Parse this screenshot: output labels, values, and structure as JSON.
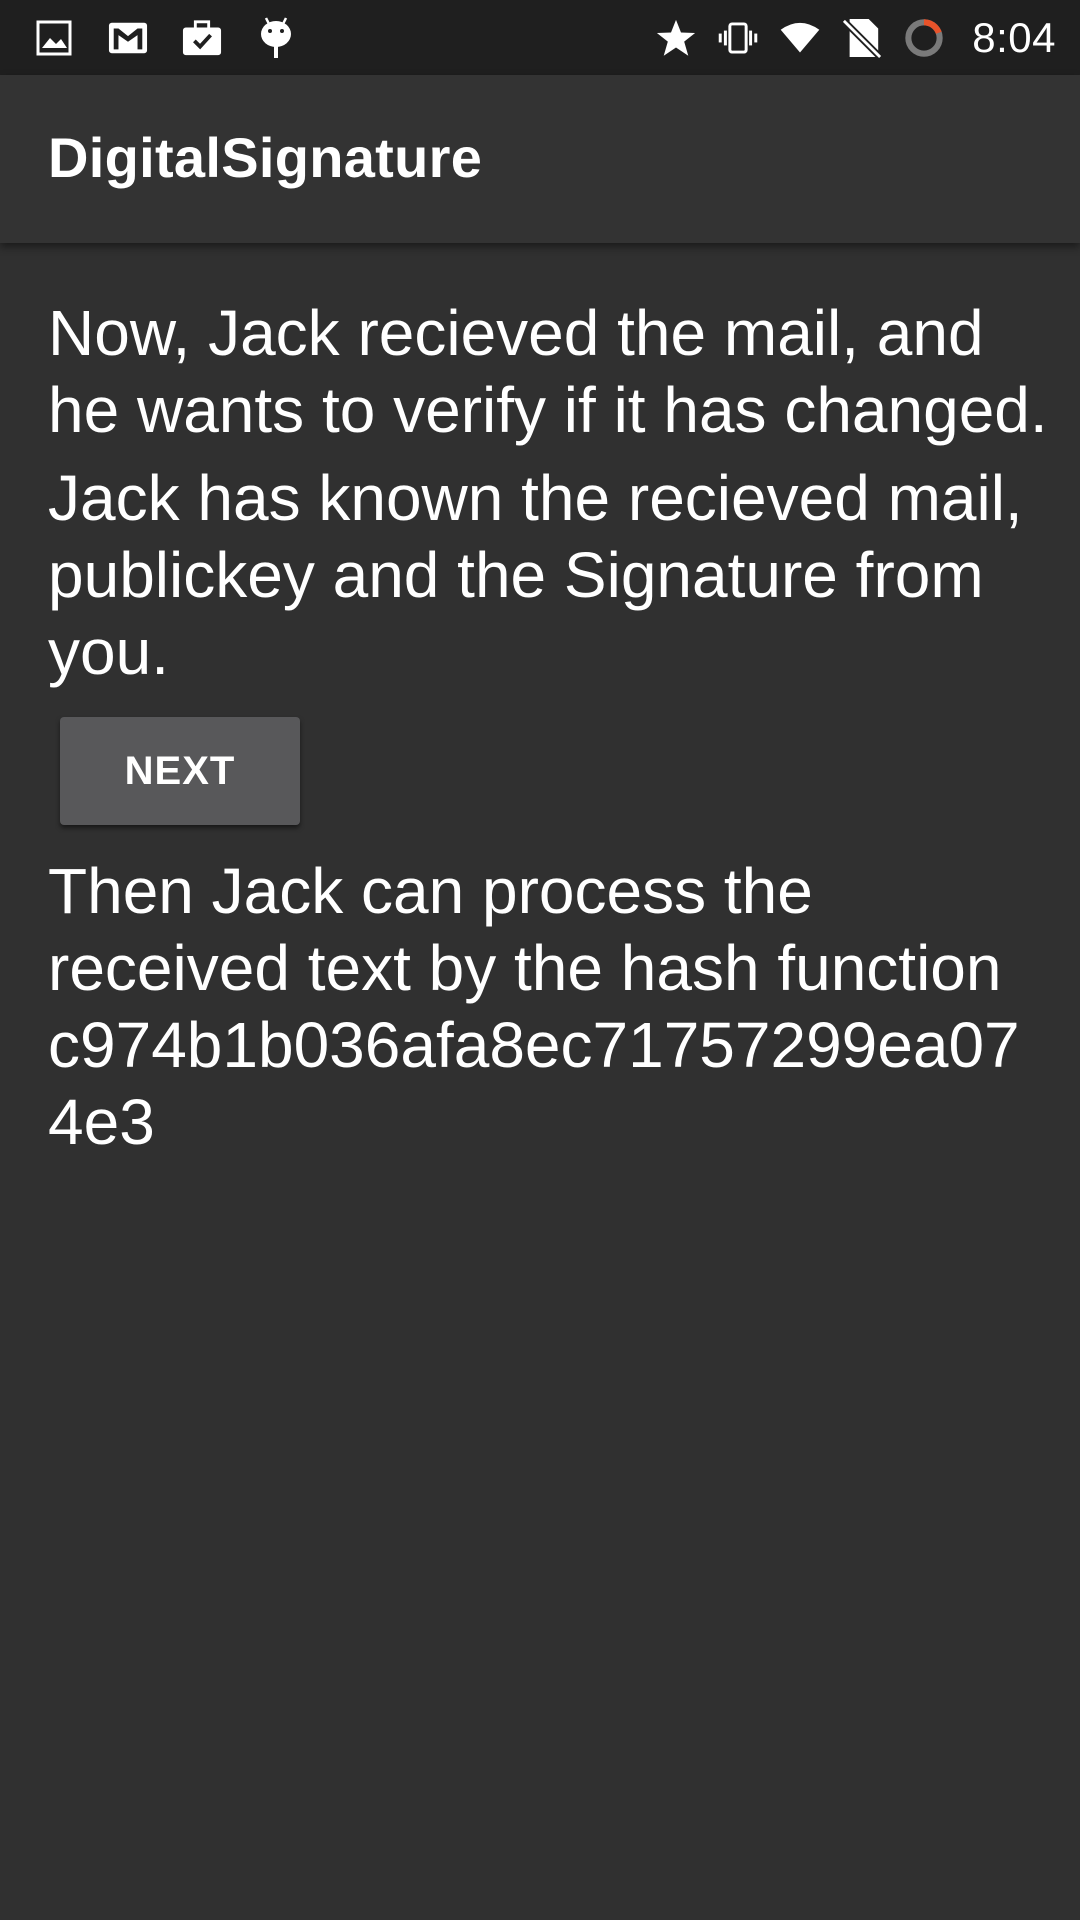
{
  "status_bar": {
    "left_icons": [
      "image-icon",
      "gmail-icon",
      "work-briefcase-icon",
      "android-debug-icon"
    ],
    "right_icons": [
      "star-icon",
      "vibrate-icon",
      "wifi-icon",
      "no-sim-icon",
      "sync-icon"
    ],
    "time": "8:04"
  },
  "app_bar": {
    "title": "DigitalSignature"
  },
  "content": {
    "para1": "Now, Jack recieved the mail, and he wants to verify if it has changed.",
    "para2": "Jack has known the recieved mail, publickey and the Signature from you.",
    "next_label": "NEXT",
    "para3": "Then Jack can process the received text by the hash function",
    "hash": "c974b1b036afa8ec71757299ea074e3"
  },
  "colors": {
    "background": "#303030",
    "status_bar": "#1f1f1f",
    "app_bar": "#333333",
    "button": "#58585a",
    "text": "#ffffff"
  }
}
